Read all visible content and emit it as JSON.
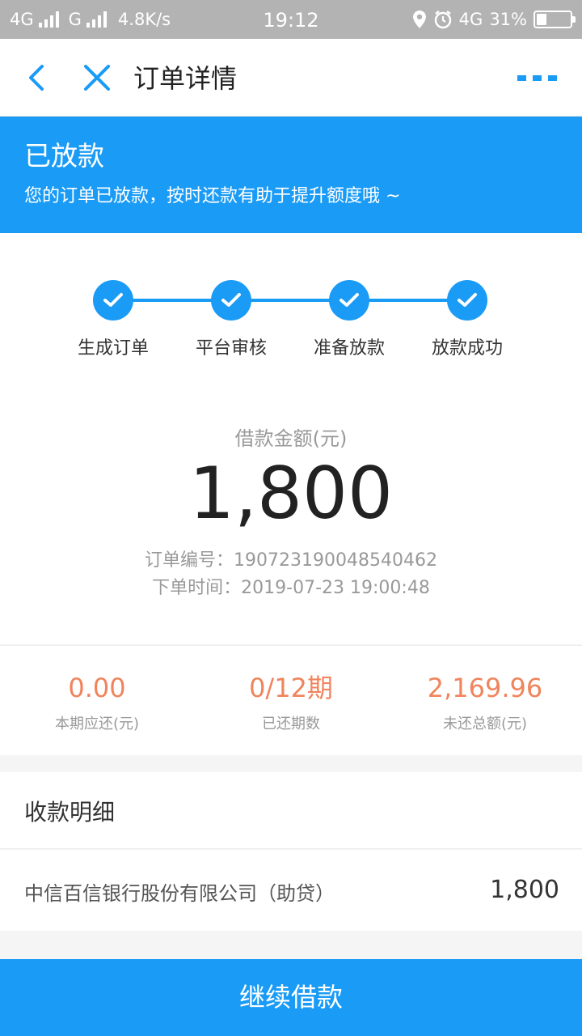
{
  "status_bar": {
    "network_1": "4G",
    "network_2": "G",
    "speed": "4.8K/s",
    "time": "19:12",
    "network_3": "4G",
    "battery": "31%"
  },
  "nav": {
    "title": "订单详情"
  },
  "banner": {
    "title": "已放款",
    "subtitle": "您的订单已放款，按时还款有助于提升额度哦 ~"
  },
  "steps": [
    {
      "label": "生成订单"
    },
    {
      "label": "平台审核"
    },
    {
      "label": "准备放款"
    },
    {
      "label": "放款成功"
    }
  ],
  "loan": {
    "amount_label": "借款金额(元)",
    "amount": "1,800",
    "order_no": "订单编号：190723190048540462",
    "order_time": "下单时间：2019-07-23 19:00:48"
  },
  "summary": [
    {
      "value": "0.00",
      "label": "本期应还(元)"
    },
    {
      "value": "0/12期",
      "label": "已还期数"
    },
    {
      "value": "2,169.96",
      "label": "未还总额(元)"
    }
  ],
  "payout": {
    "title": "收款明细",
    "name": "中信百信银行股份有限公司（助贷）",
    "amount": "1,800"
  },
  "continue_label": "继续借款",
  "colors": {
    "accent": "#1a9bf6",
    "highlight": "#f0845c"
  }
}
